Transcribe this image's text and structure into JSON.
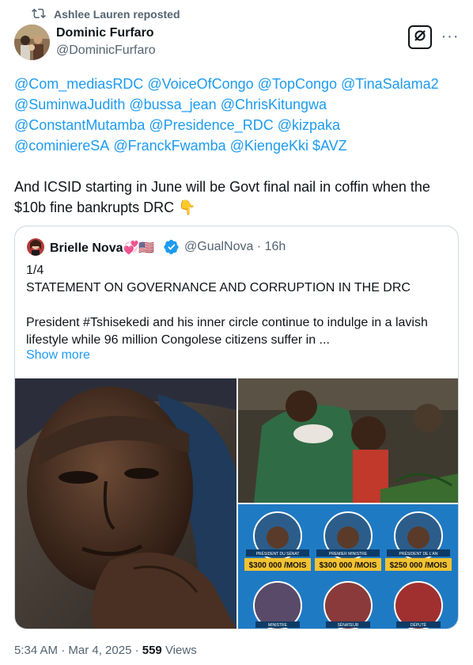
{
  "repost": {
    "text": "Ashlee Lauren reposted"
  },
  "author": {
    "name": "Dominic Furfaro",
    "handle": "@DominicFurfaro"
  },
  "mentions": [
    "@Com_mediasRDC",
    "@VoiceOfCongo",
    "@TopCongo",
    "@TinaSalama2",
    "@SuminwaJudith",
    "@bussa_jean",
    "@ChrisKitungwa",
    "@ConstantMutamba",
    "@Presidence_RDC",
    "@kizpaka",
    "@cominiereSA",
    "@FranckFwamba",
    "@KiengeKki",
    "$AVZ"
  ],
  "tweet_text": "And ICSID starting in June will be Govt final nail in coffin when the $10b fine bankrupts DRC 👇",
  "quote": {
    "name": "Brielle Nova💞🇺🇸",
    "handle": "@GualNova · 16h",
    "line1": "1/4",
    "line2": "STATEMENT ON GOVERNANCE AND CORRUPTION IN THE DRC",
    "line3": "President #Tshisekedi and his inner circle continue to indulge in a lavish lifestyle while 96 million Congolese citizens suffer in ...",
    "show_more": "Show more",
    "graphic": {
      "labels": [
        "PRÉSIDENT DU SÉNAT",
        "PREMIER MINISTRE",
        "PRÉSIDENT DE L'AN"
      ],
      "salaries": [
        "$300 000 /MOIS",
        "$300 000 /MOIS",
        "$250 000 /MOIS"
      ],
      "bottom_labels": [
        "MINISTRE",
        "SÉNATEUR",
        "DÉPUTÉ"
      ]
    }
  },
  "footer": {
    "time": "5:34 AM · Mar 4, 2025 · ",
    "views_count": "559",
    "views_label": " Views"
  },
  "colors": {
    "link": "#1d9bf0",
    "secondary": "#536471",
    "text": "#0f1419",
    "border": "#cfd9de"
  }
}
